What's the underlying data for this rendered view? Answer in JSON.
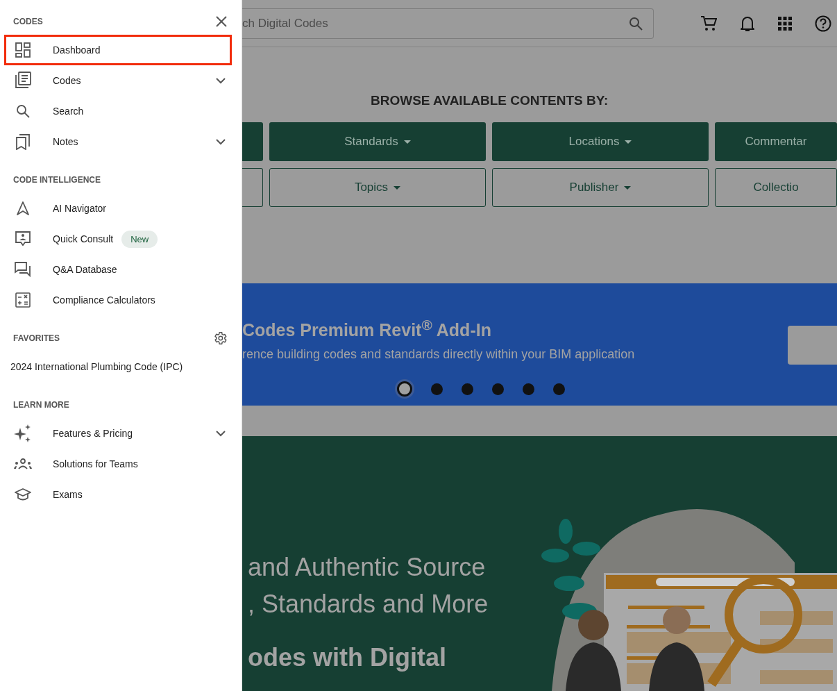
{
  "drawer": {
    "sections": [
      {
        "heading": "CODES",
        "items": [
          {
            "label": "Dashboard",
            "expandable": false,
            "highlighted": true
          },
          {
            "label": "Codes",
            "expandable": true,
            "highlighted": false
          },
          {
            "label": "Search",
            "expandable": false,
            "highlighted": false
          },
          {
            "label": "Notes",
            "expandable": true,
            "highlighted": false
          }
        ]
      },
      {
        "heading": "CODE INTELLIGENCE",
        "items": [
          {
            "label": "AI Navigator",
            "expandable": false,
            "highlighted": false
          },
          {
            "label": "Quick Consult",
            "expandable": false,
            "highlighted": false,
            "badge": "New"
          },
          {
            "label": "Q&A Database",
            "expandable": false,
            "highlighted": false
          },
          {
            "label": "Compliance Calculators",
            "expandable": false,
            "highlighted": false
          }
        ]
      },
      {
        "heading": "FAVORITES",
        "items": [
          {
            "label": "2024 International Plumbing Code (IPC)",
            "expandable": false,
            "highlighted": false
          }
        ]
      },
      {
        "heading": "LEARN MORE",
        "items": [
          {
            "label": "Features & Pricing",
            "expandable": true,
            "highlighted": false
          },
          {
            "label": "Solutions for Teams",
            "expandable": false,
            "highlighted": false
          },
          {
            "label": "Exams",
            "expandable": false,
            "highlighted": false
          }
        ]
      }
    ]
  },
  "header": {
    "search": {
      "placeholder": "ch Digital Codes"
    }
  },
  "browse": {
    "title": "BROWSE AVAILABLE CONTENTS BY:",
    "rows": [
      {
        "kind": "filled",
        "buttons": [
          {
            "kind": "edge"
          },
          {
            "kind": "full",
            "label": "Standards",
            "caret": true
          },
          {
            "kind": "full",
            "label": "Locations",
            "caret": true
          },
          {
            "kind": "full",
            "label": "Commentar",
            "caret": false
          }
        ]
      },
      {
        "kind": "outlined",
        "buttons": [
          {
            "kind": "edge"
          },
          {
            "kind": "full",
            "label": "Topics",
            "caret": true
          },
          {
            "kind": "full",
            "label": "Publisher",
            "caret": true
          },
          {
            "kind": "full",
            "label": "Collectio",
            "caret": false
          }
        ]
      }
    ]
  },
  "banner": {
    "title": "Codes Premium Revit$^{®}$ Add-In",
    "subtitle": "rence building codes and standards directly within your BIM application",
    "dots": [
      {
        "selected": true
      },
      {
        "selected": false
      },
      {
        "selected": false
      },
      {
        "selected": false
      },
      {
        "selected": false
      },
      {
        "selected": false
      }
    ]
  },
  "hero": {
    "lines": [
      "and Authentic Source",
      ", Standards and More"
    ],
    "bold_line": "odes with Digital"
  }
}
